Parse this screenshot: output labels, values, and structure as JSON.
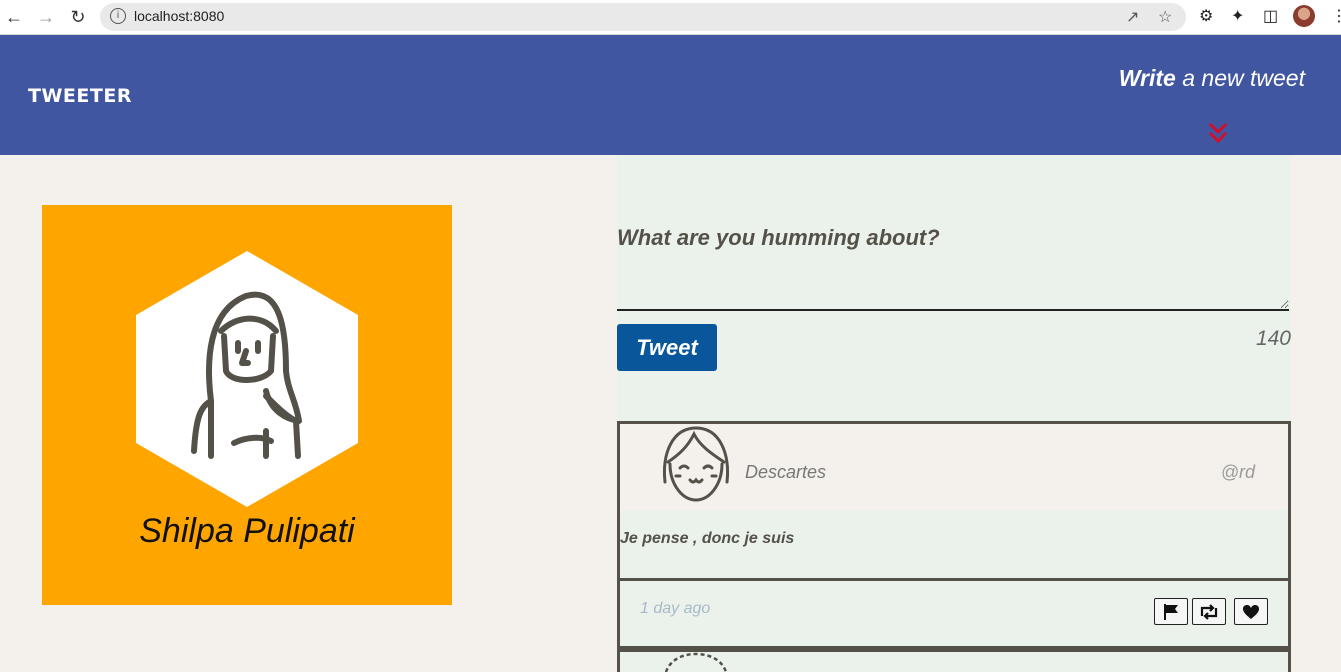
{
  "browser": {
    "url": "localhost:8080"
  },
  "header": {
    "logo": "TWEETER",
    "compose_toggle_strong": "Write",
    "compose_toggle_rest": " a new tweet",
    "accent": "#4056a1",
    "chevron_color": "#e0201b"
  },
  "profile": {
    "name": "Shilpa Pulipati",
    "background": "#ffa500"
  },
  "compose": {
    "placeholder": "What are you humming about?",
    "tweet_label": "Tweet",
    "counter": "140"
  },
  "tweets": [
    {
      "name": "Descartes",
      "handle": "@rd",
      "content": "Je pense , donc je suis",
      "time": "1 day ago",
      "actions": [
        "flag-icon",
        "retweet-icon",
        "heart-icon"
      ]
    }
  ]
}
